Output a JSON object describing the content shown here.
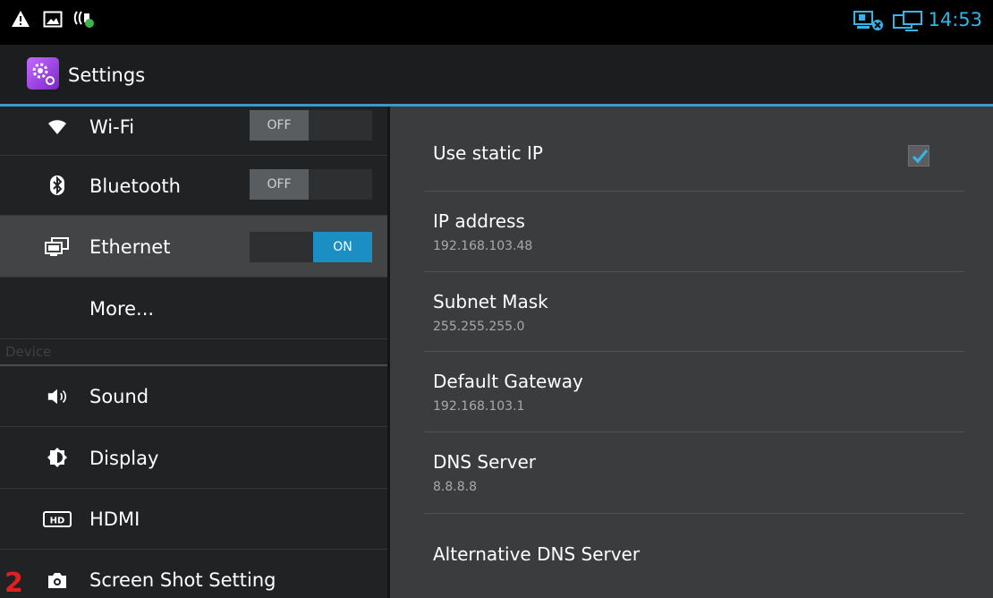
{
  "statusbar": {
    "left_icons": [
      "warning-icon",
      "image-icon",
      "phone-signal-icon"
    ],
    "right_icons": [
      "network-pc-icon",
      "monitor-icon"
    ],
    "time": "14:53",
    "accent": "#34b5e5"
  },
  "actionbar": {
    "title": "Settings"
  },
  "sidebar": {
    "items": [
      {
        "label": "Wi-Fi",
        "icon": "wifi-icon",
        "toggle": "OFF"
      },
      {
        "label": "Bluetooth",
        "icon": "bluetooth-icon",
        "toggle": "OFF"
      },
      {
        "label": "Ethernet",
        "icon": "ethernet-icon",
        "toggle": "ON",
        "selected": true
      },
      {
        "label": "More..."
      }
    ],
    "section_header": "Device",
    "device_items": [
      {
        "label": "Sound",
        "icon": "speaker-icon"
      },
      {
        "label": "Display",
        "icon": "display-icon"
      },
      {
        "label": "HDMI",
        "icon": "hdmi-icon",
        "icon_text": "HD"
      },
      {
        "label": "Screen Shot Setting",
        "icon": "camera-icon"
      }
    ]
  },
  "detail": {
    "static_ip": {
      "title": "Use static IP",
      "checked": true
    },
    "prefs": [
      {
        "title": "IP address",
        "summary": "192.168.103.48"
      },
      {
        "title": "Subnet Mask",
        "summary": "255.255.255.0"
      },
      {
        "title": "Default Gateway",
        "summary": "192.168.103.1"
      },
      {
        "title": "DNS Server",
        "summary": "8.8.8.8"
      },
      {
        "title": "Alternative DNS Server"
      }
    ]
  },
  "annotation": {
    "label": "2"
  },
  "colors": {
    "selection_bg": "#424446",
    "toggle_on": "#1b8fc4",
    "checkbox_tick": "#34b5e5"
  }
}
